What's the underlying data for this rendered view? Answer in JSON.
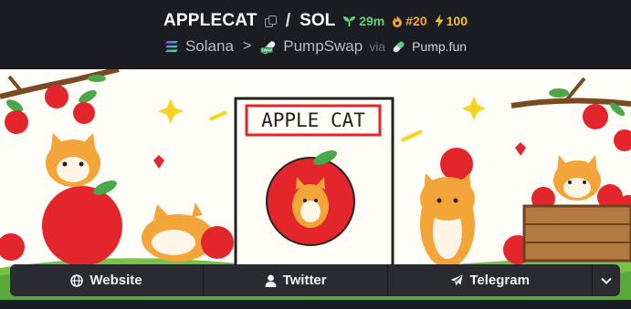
{
  "token": {
    "ticker": "APPLECAT",
    "quote": "SOL",
    "age": "29m",
    "rank": "#20",
    "boosts": "100"
  },
  "breadcrumb": {
    "chain": "Solana",
    "dex": "PumpSwap",
    "via": "via",
    "platform": "Pump.fun"
  },
  "banner": {
    "sign_text": "APPLE CAT"
  },
  "links": {
    "website": "Website",
    "twitter": "Twitter",
    "telegram": "Telegram"
  },
  "colors": {
    "background": "#1b1c21",
    "button": "#2a2b31",
    "age_green": "#5fd07a",
    "rank_orange": "#f5a623",
    "boost_yellow": "#f5c518"
  }
}
